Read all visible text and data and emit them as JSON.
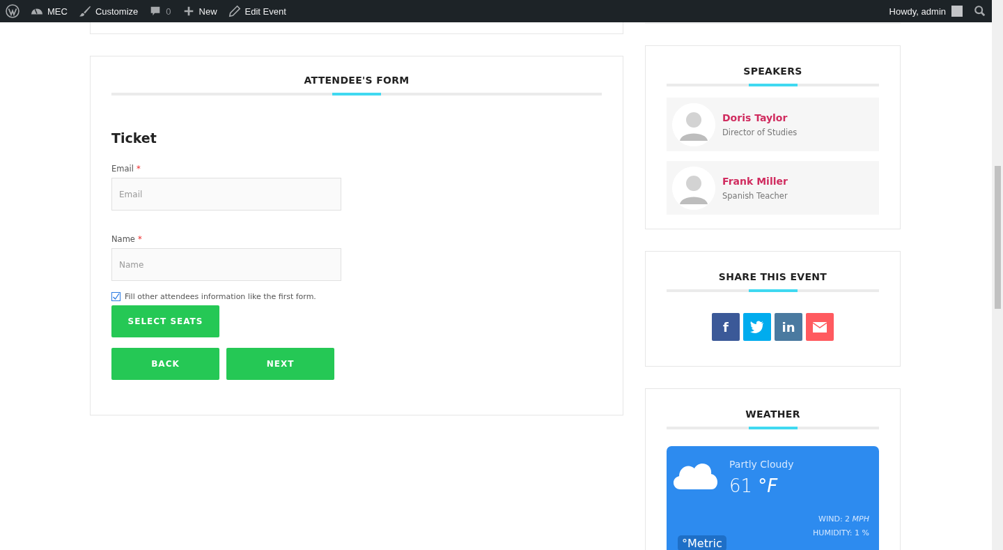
{
  "admin_bar": {
    "items": [
      {
        "kind": "wordpress"
      },
      {
        "kind": "dashboard",
        "label": "MEC"
      },
      {
        "kind": "brush",
        "label": "Customize"
      },
      {
        "kind": "comment",
        "label": "0"
      },
      {
        "kind": "plus",
        "label": "New"
      },
      {
        "kind": "pencil",
        "label": "Edit Event"
      }
    ],
    "greeting": "Howdy, admin"
  },
  "attendee_form": {
    "title": "ATTENDEE'S FORM",
    "ticket_heading": "Ticket",
    "fields": [
      {
        "label": "Email",
        "required_mark": "*",
        "placeholder": "Email"
      },
      {
        "label": "Name",
        "required_mark": "*",
        "placeholder": "Name"
      }
    ],
    "checkbox": {
      "label": "Fill other attendees information like the first form.",
      "checked": true
    },
    "select_seats": "SELECT SEATS",
    "buttons": [
      "BACK",
      "NEXT"
    ]
  },
  "speakers": {
    "title": "SPEAKERS",
    "items": [
      {
        "name": "Doris Taylor",
        "role": "Director of Studies"
      },
      {
        "name": "Frank Miller",
        "role": "Spanish Teacher"
      }
    ]
  },
  "share": {
    "title": "SHARE THIS EVENT",
    "buttons": [
      {
        "kind": "facebook",
        "glyph": "f",
        "color": "#3b5998"
      },
      {
        "kind": "twitter",
        "color": "#00acee"
      },
      {
        "kind": "linkedin",
        "glyph": "in",
        "color": "#4a7aa0"
      },
      {
        "kind": "email",
        "color": "#ff5a5f"
      }
    ]
  },
  "weather": {
    "title": "WEATHER",
    "condition": "Partly Cloudy",
    "temperature": "61",
    "unit": "°F",
    "wind": "WIND: 2 *MPH*",
    "humidity": "HUMIDITY: 1 %",
    "unit_toggle": "°Metric"
  }
}
